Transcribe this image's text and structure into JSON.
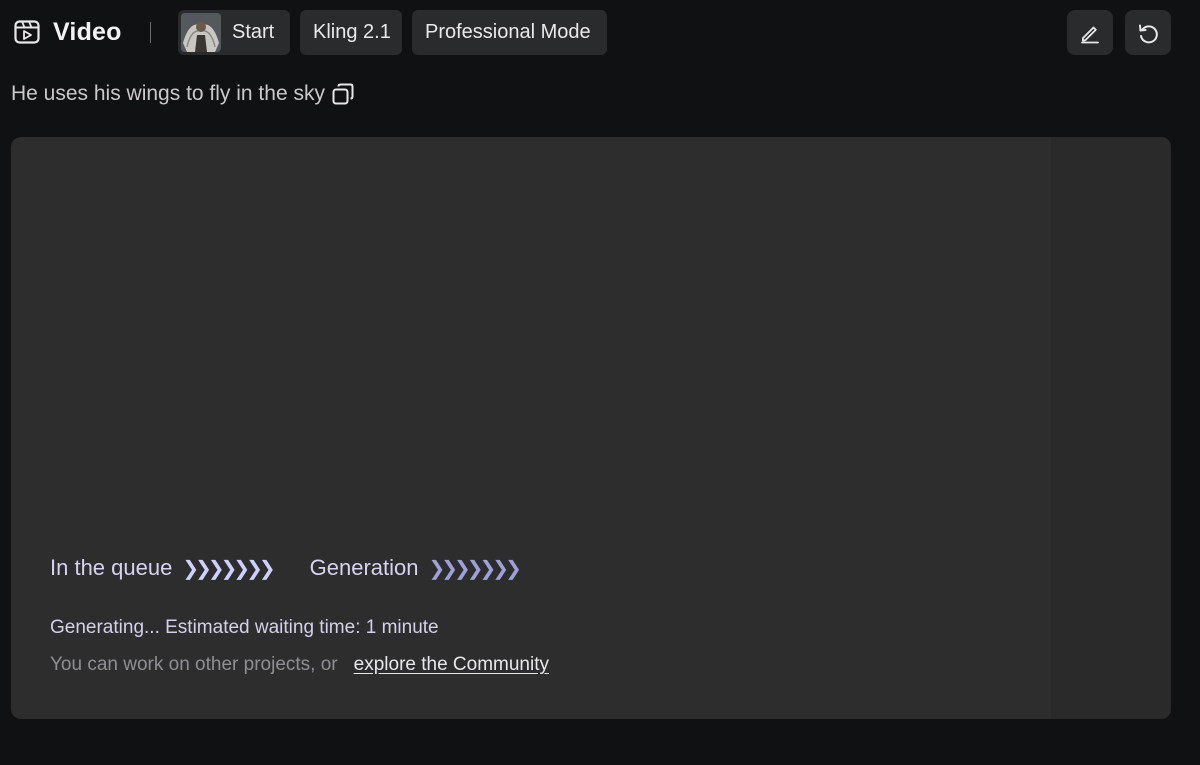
{
  "header": {
    "title": "Video",
    "icon": "video-icon",
    "chips": {
      "start": {
        "label": "Start",
        "thumbnail": "winged-figure-thumbnail"
      },
      "model": "Kling 2.1",
      "mode": "Professional Mode"
    },
    "actions": [
      "edit-icon",
      "undo-icon"
    ]
  },
  "prompt": {
    "text": "He uses his wings to fly in the sky",
    "icon": "copy-icon"
  },
  "preview": {
    "stages": [
      "In the queue",
      "Generation"
    ],
    "stage_chevrons": "❯❯❯❯❯❯❯",
    "status": "Generating... Estimated waiting time: 1 minute",
    "hint": "You can work on other projects, or",
    "community_link": "explore the Community"
  },
  "colors": {
    "background": "#101112",
    "card": "#2d2d2e",
    "chip": "#2a2b2d",
    "accent_text": "#d6d3ef"
  }
}
